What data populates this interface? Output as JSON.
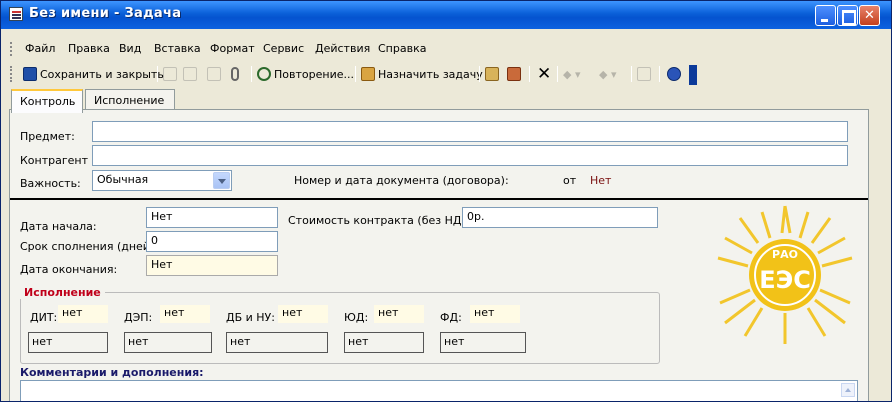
{
  "window": {
    "title": "Без имени - Задача"
  },
  "menu": [
    "Файл",
    "Правка",
    "Вид",
    "Вставка",
    "Формат",
    "Сервис",
    "Действия",
    "Справка"
  ],
  "toolbar": {
    "save_close": "Сохранить и закрыть",
    "recurrence": "Повторение...",
    "assign": "Назначить задачу",
    "icons": [
      "save-icon",
      "cut-icon",
      "copy-icon",
      "paste-icon",
      "attach-icon",
      "recurrence-icon",
      "assign-icon",
      "address-book-icon",
      "category-icon",
      "delete-icon",
      "up-icon",
      "down-icon",
      "insert-icon",
      "help-icon"
    ]
  },
  "tabs": [
    "Контроль",
    "Исполнение"
  ],
  "form": {
    "subject_label": "Предмет:",
    "subject_value": "",
    "contractor_label": "Контрагент",
    "contractor_value": "",
    "importance_label": "Важность:",
    "importance_value": "Обычная",
    "doc_label": "Номер и дата документа (договора):",
    "doc_from": "от",
    "doc_value": "Нет",
    "start_label": "Дата начала:",
    "start_value": "Нет",
    "duration_label": "Срок сполнения (дней):",
    "duration_value": "0",
    "end_label": "Дата окончания:",
    "end_value": "Нет",
    "cost_label": "Стоимость контракта (без НДС):",
    "cost_value": "0р."
  },
  "execution": {
    "title": "Исполнение",
    "departments": [
      {
        "label": "ДИТ:",
        "value": "нет",
        "field": "нет"
      },
      {
        "label": "ДЭП:",
        "value": "нет",
        "field": "нет"
      },
      {
        "label": "ДБ и НУ:",
        "value": "нет",
        "field": "нет"
      },
      {
        "label": "ЮД:",
        "value": "нет",
        "field": "нет"
      },
      {
        "label": "ФД:",
        "value": "нет",
        "field": "нет"
      }
    ]
  },
  "comments": {
    "label": "Комментарии и дополнения:",
    "value": ""
  },
  "logo": {
    "text": "ЕЭС",
    "top": "РАО"
  },
  "colors": {
    "titlebar": "#0a5fd8",
    "accent": "#c0001a",
    "logo": "#f2c218"
  }
}
